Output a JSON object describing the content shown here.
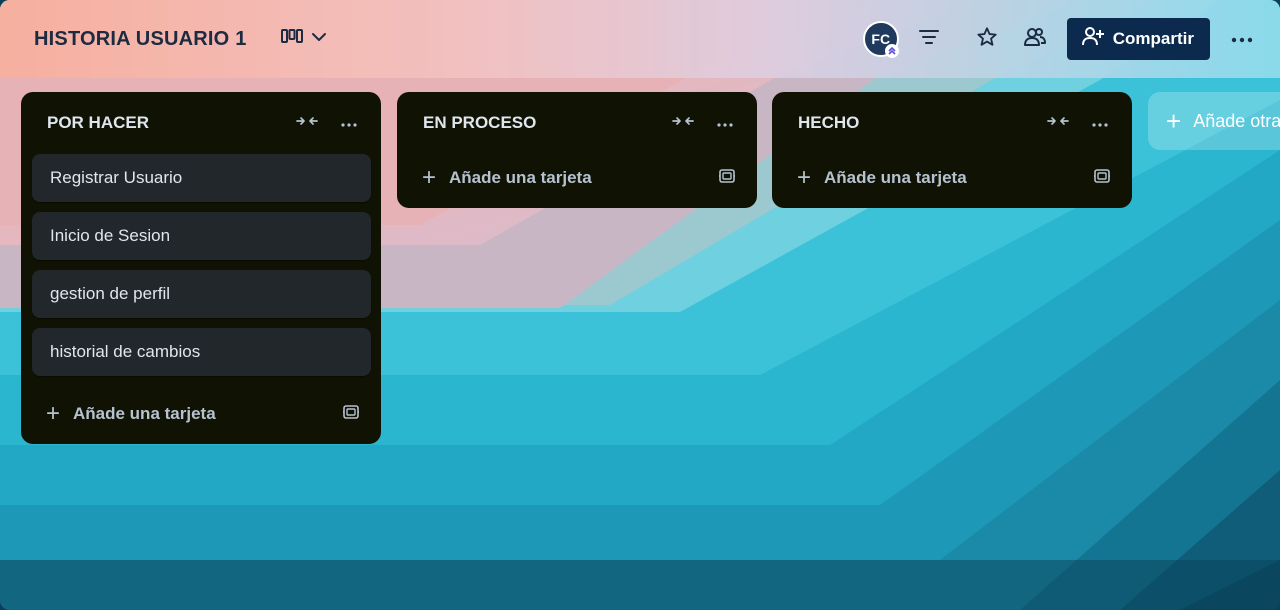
{
  "board": {
    "title": "HISTORIA USUARIO 1",
    "view_icon": "board-columns-icon",
    "avatar_initials": "FC",
    "share_label": "Compartir",
    "colors": {
      "header_text": "#1c2b41",
      "share_button": "#0c2a4d",
      "list_bg": "#101204",
      "card_bg": "#22272b"
    }
  },
  "lists": [
    {
      "title": "POR HACER",
      "cards": [
        "Registrar Usuario",
        "Inicio de Sesion",
        "gestion de perfil",
        "historial de cambios"
      ],
      "add_label": "Añade una tarjeta"
    },
    {
      "title": "EN PROCESO",
      "cards": [],
      "add_label": "Añade una tarjeta"
    },
    {
      "title": "HECHO",
      "cards": [],
      "add_label": "Añade una tarjeta"
    }
  ],
  "add_list_label": "Añade otra lista"
}
